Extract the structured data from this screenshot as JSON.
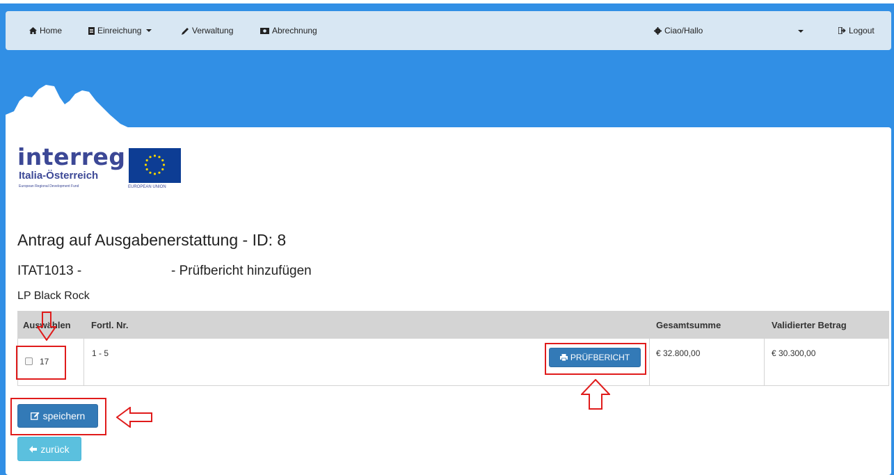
{
  "nav": {
    "home": "Home",
    "einreichung": "Einreichung",
    "verwaltung": "Verwaltung",
    "abrechnung": "Abrechnung",
    "user": "Ciao/Hallo",
    "logout": "Logout"
  },
  "logo": {
    "wordmark": "interreg",
    "program": "Italia-Österreich",
    "fund": "European Regional Development Fund",
    "eu": "EUROPEAN UNION"
  },
  "page": {
    "title": "Antrag auf Ausgabenerstattung - ID: 8",
    "project_code": "ITAT1013 -",
    "subtitle": "- Prüfbericht hinzufügen",
    "partner": "LP Black Rock"
  },
  "table": {
    "columns": [
      "Auswählen",
      "Fortl. Nr.",
      "Gesamtsumme",
      "Validierter Betrag"
    ],
    "rows": [
      {
        "select_value": "17",
        "fortl_nr": "1 - 5",
        "action_label": "PRÜFBERICHT",
        "gesamtsumme": "€ 32.800,00",
        "validierter_betrag": "€ 30.300,00"
      }
    ]
  },
  "buttons": {
    "save": "speichern",
    "back": "zurück"
  },
  "colors": {
    "background": "#318fe5",
    "navbar": "#d8e7f3",
    "primary_button": "#337ab7",
    "info_button": "#5bc0de",
    "annotation": "#e01b1b"
  }
}
